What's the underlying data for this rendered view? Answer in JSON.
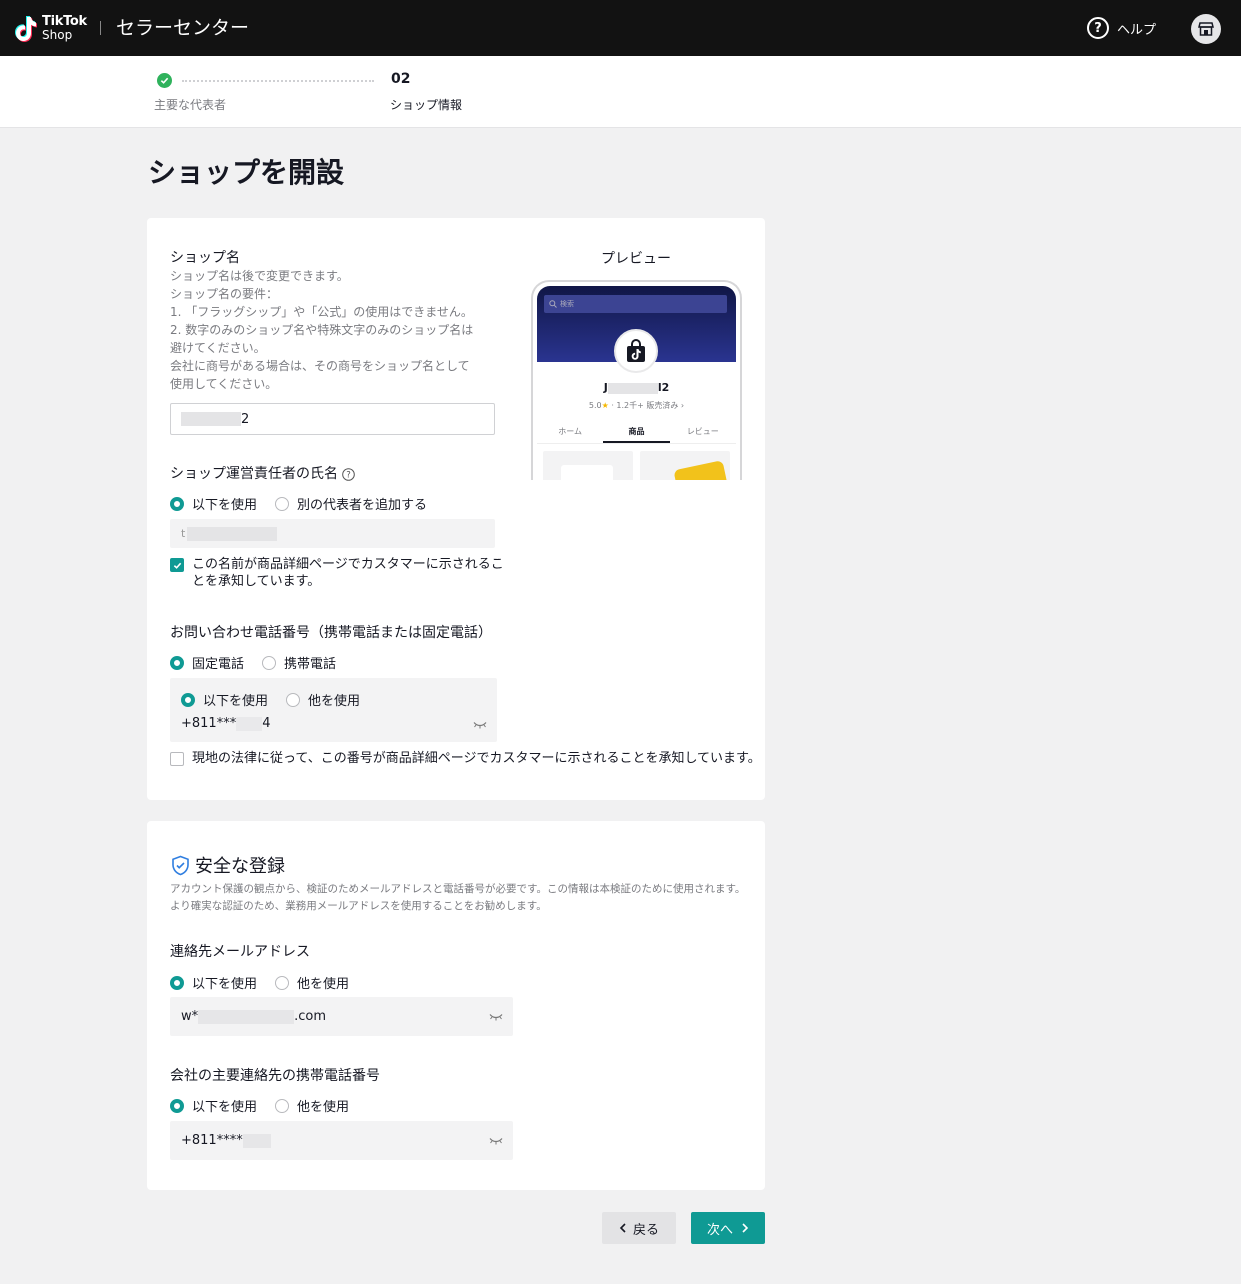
{
  "header": {
    "logo_line1": "TikTok",
    "logo_line2": "Shop",
    "app_title": "セラーセンター",
    "help_label": "ヘルプ",
    "help_icon": "question-circle-icon",
    "store_icon": "store-icon"
  },
  "stepper": {
    "step1_label": "主要な代表者",
    "step2_number": "02",
    "step2_label": "ショップ情報",
    "done_color": "#2fb25c"
  },
  "page": {
    "title": "ショップを開設"
  },
  "shop_name": {
    "label": "ショップ名",
    "desc": [
      "ショップ名は後で変更できます。",
      "ショップ名の要件：",
      "1. 「フラッグシップ」や「公式」の使用はできません。",
      "2. 数字のみのショップ名や特殊文字のみのショップ名は",
      "避けてください。",
      "会社に商号がある場合は、その商号をショップ名として",
      "使用してください。"
    ],
    "value_suffix": "2"
  },
  "preview": {
    "label": "プレビュー",
    "search_placeholder": "検索",
    "name_start": "J",
    "name_end": "l2",
    "rating": "5.0",
    "sales": "· 1.2千+ 販売済み ›",
    "tabs": [
      "ホーム",
      "商品",
      "レビュー"
    ],
    "active_tab": 1
  },
  "owner": {
    "label": "ショップ運営責任者の氏名",
    "info_icon": "info-circle-icon",
    "option_use": "以下を使用",
    "option_add": "別の代表者を追加する",
    "value_start": "t",
    "consent": [
      "この名前が商品詳細ページでカスタマーに示されるこ",
      "とを承知しています。"
    ]
  },
  "phone": {
    "label": "お問い合わせ電話番号（携帯電話または固定電話）",
    "type_landline": "固定電話",
    "type_mobile": "携帯電話",
    "option_use": "以下を使用",
    "option_other": "他を使用",
    "value_start": "+811***",
    "value_end": "4",
    "consent": "現地の法律に従って、この番号が商品詳細ページでカスタマーに示されることを承知しています。"
  },
  "secure": {
    "title": "安全な登録",
    "icon": "shield-check-icon",
    "desc": "アカウント保護の観点から、検証のためメールアドレスと電話番号が必要です。この情報は本検証のために使用されます。より確実な認証のため、業務用メールアドレスを使用することをお勧めします。"
  },
  "email": {
    "label": "連絡先メールアドレス",
    "option_use": "以下を使用",
    "option_other": "他を使用",
    "value_start": "w*",
    "value_end": ".com"
  },
  "company_phone": {
    "label": "会社の主要連絡先の携帯電話番号",
    "option_use": "以下を使用",
    "option_other": "他を使用",
    "value_start": "+811****"
  },
  "footer": {
    "back": "戻る",
    "next": "次へ"
  },
  "colors": {
    "accent": "#0f9a94",
    "topbar": "#121212"
  }
}
